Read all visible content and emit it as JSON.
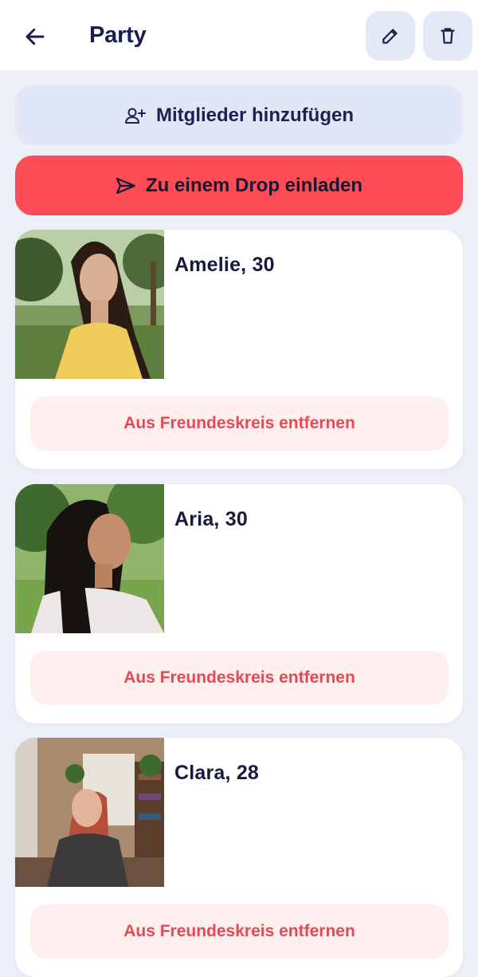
{
  "header": {
    "title": "Party",
    "back_icon": "arrow-left-icon",
    "edit_icon": "pencil-icon",
    "delete_icon": "trash-icon"
  },
  "actions": {
    "add_members_label": "Mitglieder hinzufügen",
    "add_members_icon": "person-add-icon",
    "invite_label": "Zu einem Drop einladen",
    "invite_icon": "send-icon"
  },
  "members": [
    {
      "name": "Amelie, 30",
      "remove_label": "Aus Freundeskreis entfernen"
    },
    {
      "name": "Aria, 30",
      "remove_label": "Aus Freundeskreis entfernen"
    },
    {
      "name": "Clara, 28",
      "remove_label": "Aus Freundeskreis entfernen"
    }
  ],
  "colors": {
    "accent": "#fc4d57",
    "secondary_button": "#e1e7f7",
    "remove_bg": "#ffefef",
    "remove_text": "#e24b53",
    "background": "#eef0f8"
  }
}
